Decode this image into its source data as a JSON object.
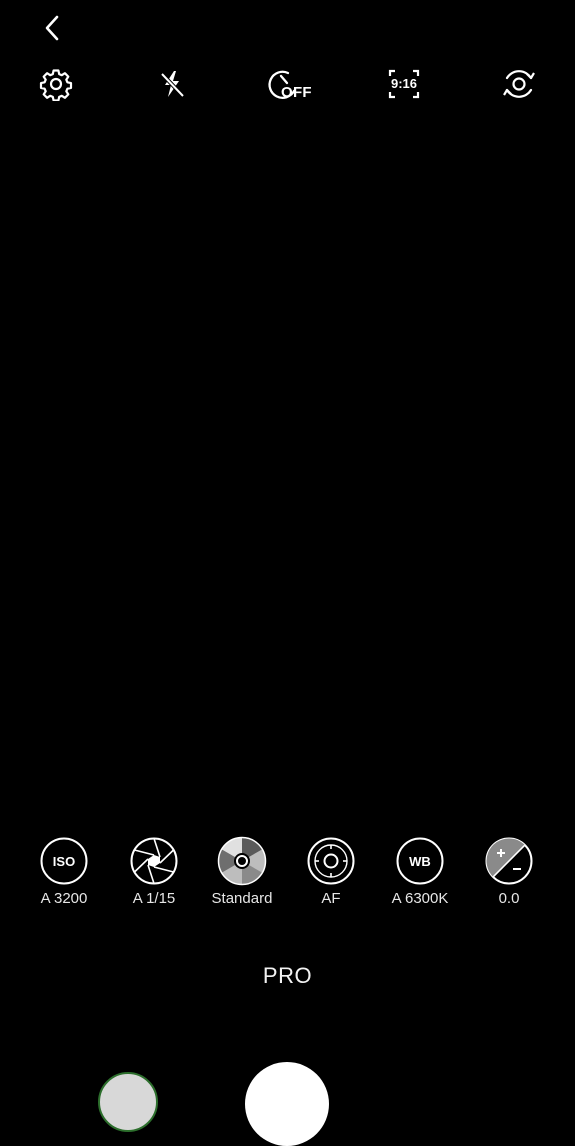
{
  "top_bar": {
    "back_icon": "chevron-left-icon",
    "settings_icon": "gear-icon",
    "flash_icon": "flash-off-icon",
    "timer_icon": "timer-icon",
    "timer_text": "OFF",
    "ratio_icon": "aspect-ratio-icon",
    "ratio_text": "9:16",
    "switch_icon": "switch-camera-icon"
  },
  "pro_controls": [
    {
      "icon": "iso-icon",
      "icon_text": "ISO",
      "value": "A 3200"
    },
    {
      "icon": "shutter-speed-icon",
      "value": "A 1/15"
    },
    {
      "icon": "color-tone-icon",
      "value": "Standard"
    },
    {
      "icon": "focus-icon",
      "value": "AF"
    },
    {
      "icon": "white-balance-icon",
      "icon_text": "WB",
      "value": "A 6300K"
    },
    {
      "icon": "exposure-icon",
      "value": "0.0"
    }
  ],
  "mode": {
    "label": "PRO"
  },
  "colors": {
    "background": "#000000",
    "foreground": "#ffffff"
  }
}
